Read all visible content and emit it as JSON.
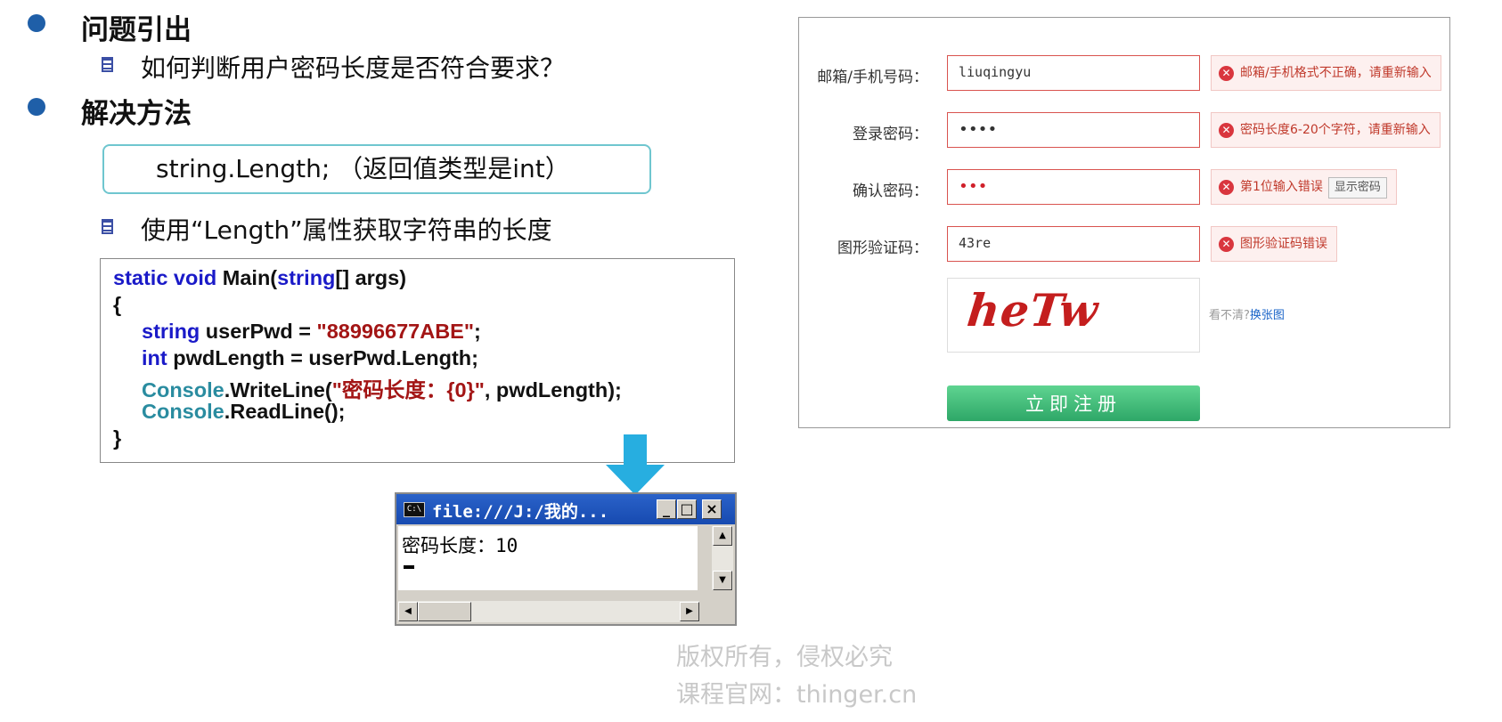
{
  "slide": {
    "section1": {
      "title": "问题引出",
      "item": "如何判断用户密码长度是否符合要求？"
    },
    "section2": {
      "title": "解决方法",
      "callout": "string.Length; （返回值类型是int）",
      "item": "使用“Length”属性获取字符串的长度"
    }
  },
  "code": {
    "l1_kw": "static void",
    "l1_rest": " Main(",
    "l1_kw2": "string",
    "l1_end": "[] args)",
    "l2": "{",
    "l3_kw": "string",
    "l3_mid": " userPwd = ",
    "l3_str": "\"88996677ABE\"",
    "l3_end": ";",
    "l4_kw": "int",
    "l4_rest": " pwdLength = userPwd.Length;",
    "l5_cls": "Console",
    "l5_mid": ".WriteLine(",
    "l5_str": "\"密码长度：{0}\"",
    "l5_end": ", pwdLength);",
    "l6_cls": "Console",
    "l6_rest": ".ReadLine();",
    "l7": "}"
  },
  "console": {
    "icon": "C:\\",
    "title": "file:///J:/我的...",
    "output": "密码长度：10",
    "min": "_",
    "max": "□",
    "close": "×"
  },
  "watermark": {
    "line1": "版权所有，侵权必究",
    "line2": "课程官网：thinger.cn"
  },
  "form": {
    "fields": [
      {
        "label": "邮箱/手机号码：",
        "value": "liuqingyu",
        "error": "邮箱/手机格式不正确，请重新输入"
      },
      {
        "label": "登录密码：",
        "value": "••••",
        "error": "密码长度6-20个字符，请重新输入"
      },
      {
        "label": "确认密码：",
        "value": "•••",
        "error": "第1位输入错误",
        "show_btn": "显示密码"
      },
      {
        "label": "图形验证码：",
        "value": "43re",
        "error": "图形验证码错误"
      }
    ],
    "captcha": "heTw",
    "refresh_prefix": "看不清?",
    "refresh_link": "换张图",
    "submit": "立即注册"
  },
  "colors": {
    "accent_blue": "#1f5fa8",
    "error_red": "#d9534f",
    "submit_green": "#2ea767",
    "arrow": "#27aee0"
  }
}
